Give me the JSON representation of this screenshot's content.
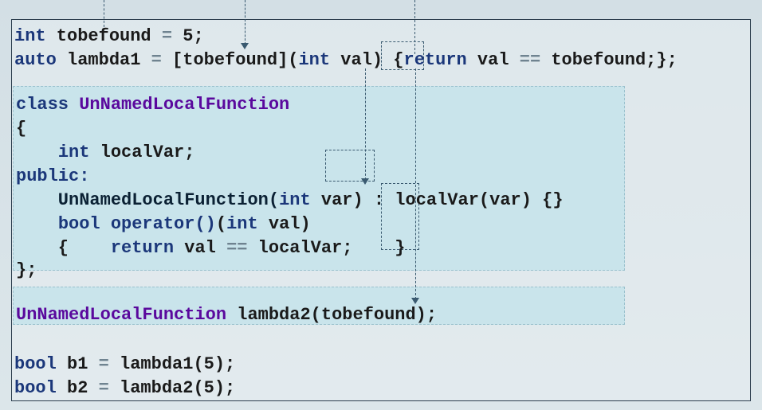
{
  "code": {
    "l1_a": "int",
    "l1_b": " tobefound ",
    "l1_c": "=",
    "l1_d": " 5;",
    "l2_a": "auto",
    "l2_b": " lambda1 ",
    "l2_c": "=",
    "l2_d": " [tobefound](",
    "l2_e": "int",
    "l2_f": " val)",
    "l2_g": " {",
    "l2_h": "return",
    "l2_i": " val ",
    "l2_j": "==",
    "l2_k": " tobefound;};",
    "l3_a": "class ",
    "l3_b": "UnNamedLocalFunction",
    "l4": "{",
    "l5_a": "    ",
    "l5_b": "int",
    "l5_c": " localVar;",
    "l6": "public:",
    "l7_a": "    UnNamedLocalFunction(",
    "l7_b": "int",
    "l7_c": " var)",
    "l7_d": " : localVar(var) {}",
    "l8_a": "    ",
    "l8_b": "bool",
    "l8_c": " ",
    "l8_d": "operator()",
    "l8_e": "(",
    "l8_f": "int",
    "l8_g": " val)",
    "l9_a": "    {    ",
    "l9_b": "return",
    "l9_c": " val ",
    "l9_d": "==",
    "l9_e": " localVar;    }",
    "l10": "};",
    "l11_a": "UnNamedLocalFunction",
    "l11_b": " lambda2(tobefound);",
    "l12_a": "bool",
    "l12_b": " b1 ",
    "l12_c": "=",
    "l12_d": " lambda1(5);",
    "l13_a": "bool",
    "l13_b": " b2 ",
    "l13_c": "=",
    "l13_d": " lambda2(5);"
  }
}
